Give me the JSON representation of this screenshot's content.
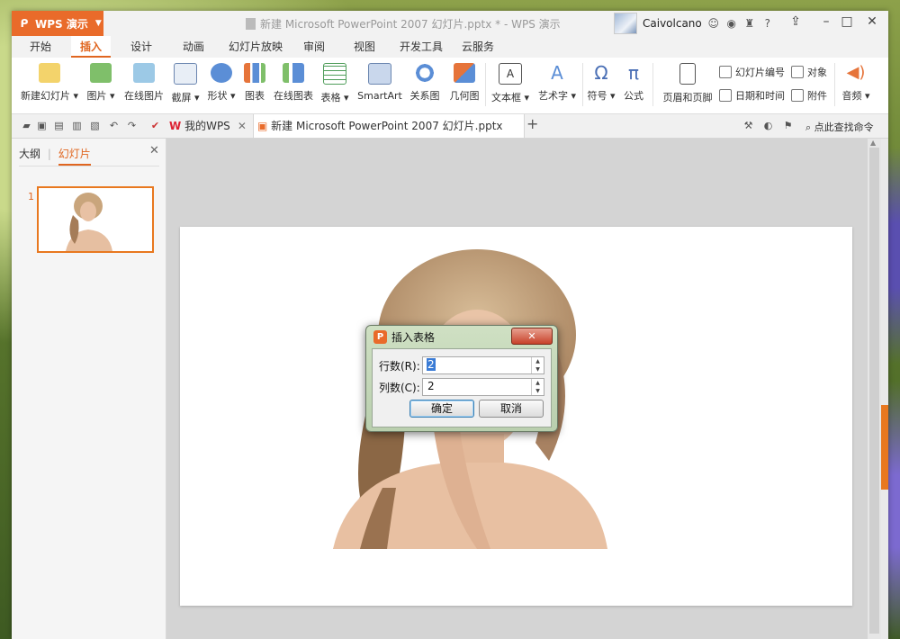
{
  "app": {
    "name": "WPS 演示"
  },
  "window": {
    "title": "新建 Microsoft PowerPoint 2007 幻灯片.pptx * - WPS 演示"
  },
  "user": {
    "name": "Caivolcano"
  },
  "menu": [
    "开始",
    "插入",
    "设计",
    "动画",
    "幻灯片放映",
    "审阅",
    "视图",
    "开发工具",
    "云服务"
  ],
  "menu_active": "插入",
  "ribbon": {
    "new_slide": "新建幻灯片",
    "picture": "图片",
    "online_picture": "在线图片",
    "screenshot": "截屏",
    "shape": "形状",
    "chart": "图表",
    "online_chart": "在线图表",
    "table": "表格",
    "smartart": "SmartArt",
    "relation": "关系图",
    "geometry": "几何图",
    "textbox": "文本框",
    "wordart": "艺术字",
    "symbol": "符号",
    "formula": "公式",
    "header_footer": "页眉和页脚",
    "slide_number": "幻灯片编号",
    "object": "对象",
    "datetime": "日期和时间",
    "attachment": "附件",
    "audio": "音频"
  },
  "tabs": {
    "mywps": "我的WPS",
    "doc": "新建 Microsoft PowerPoint 2007 幻灯片.pptx *",
    "find": "点此查找命令"
  },
  "left_pane": {
    "outline": "大纲",
    "slides": "幻灯片",
    "slide_num": "1"
  },
  "dialog": {
    "title": "插入表格",
    "rows_label": "行数(R):",
    "rows_value": "2",
    "cols_label": "列数(C):",
    "cols_value": "2",
    "ok": "确定",
    "cancel": "取消"
  },
  "colors": {
    "accent": "#e96b2a"
  }
}
